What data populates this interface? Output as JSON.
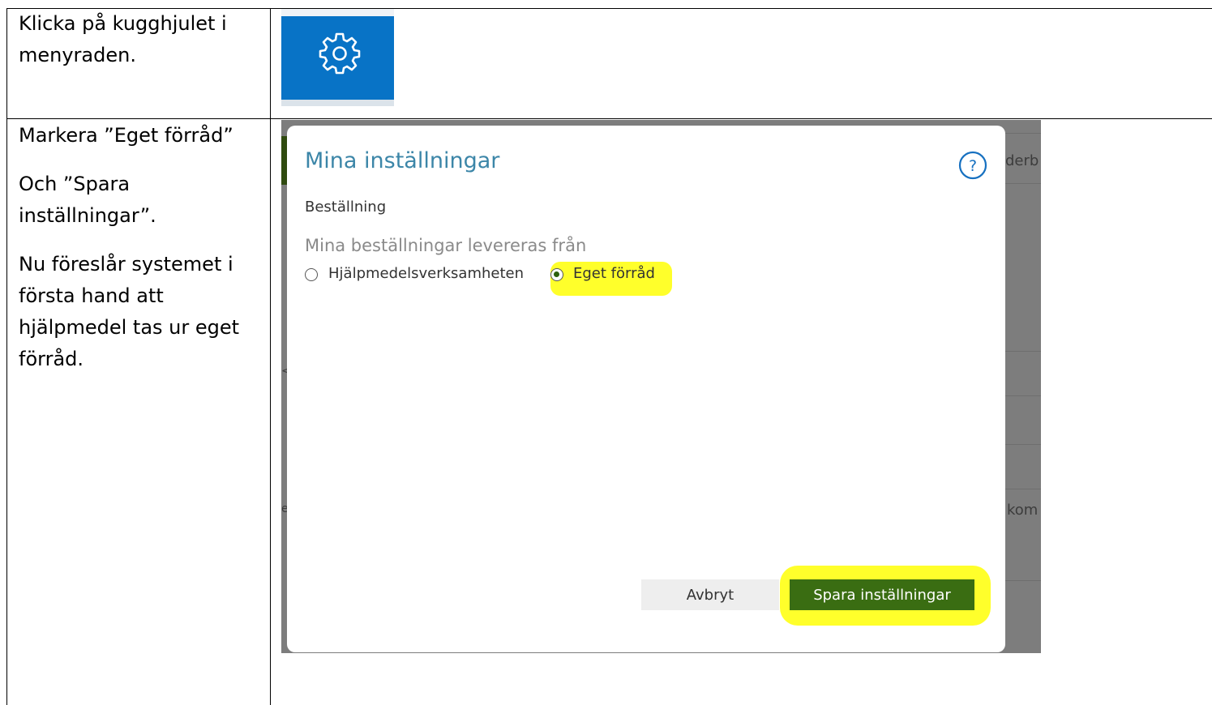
{
  "instructions": {
    "row1": {
      "lines": [
        "Klicka på kugghjulet i",
        "menyraden."
      ]
    },
    "row2": {
      "para1": "Markera ”Eget förråd”",
      "para2_lines": [
        "Och ”Spara",
        "inställningar”."
      ],
      "para3_lines": [
        "Nu föreslår systemet i",
        "första hand att",
        "hjälpmedel tas ur eget",
        "förråd."
      ]
    }
  },
  "toolbar": {
    "gear_icon": "gear-icon",
    "accent": "#0873c6"
  },
  "background_fragments": {
    "right_top": "derb",
    "right_mid": "kom",
    "left_mid": "<",
    "left_low": "e"
  },
  "dialog": {
    "title": "Mina inställningar",
    "help_icon": "question-circle-icon",
    "section": "Beställning",
    "field_label": "Mina beställningar levereras från",
    "options": [
      {
        "label": "Hjälpmedelsverksamheten",
        "selected": false
      },
      {
        "label": "Eget förråd",
        "selected": true
      }
    ],
    "cancel_label": "Avbryt",
    "save_label": "Spara inställningar",
    "highlight_color": "#ffff2b",
    "primary_color": "#3a6d12"
  }
}
